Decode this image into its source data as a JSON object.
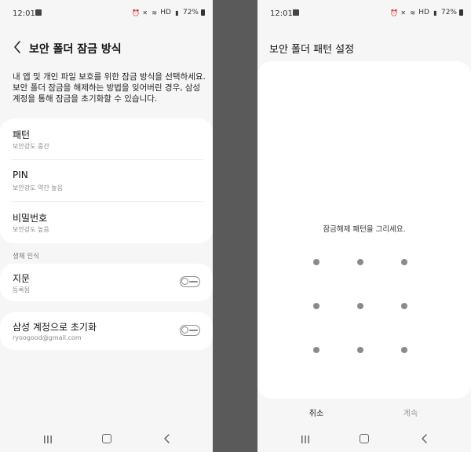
{
  "status": {
    "time": "12:01",
    "network": "HD",
    "battery": "72%"
  },
  "left": {
    "title": "보안 폴더 잠금 방식",
    "intro": "내 앱 및 개인 파일 보호를 위한 잠금 방식을 선택하세요. 보안 폴더 잠금을 해제하는 방법을 잊어버린 경우, 삼성 계정을 통해 잠금을 초기화할 수 있습니다.",
    "options": [
      {
        "title": "패턴",
        "sub": "보안강도 중간"
      },
      {
        "title": "PIN",
        "sub": "보안강도 약간 높음"
      },
      {
        "title": "비밀번호",
        "sub": "보안강도 높음"
      }
    ],
    "biometrics_label": "생체 인식",
    "fingerprint": {
      "title": "지문",
      "sub": "등록됨",
      "enabled": false
    },
    "samsung_reset": {
      "title": "삼성 계정으로 초기화",
      "sub": "ryoogood@gmail.com",
      "enabled": false
    }
  },
  "right": {
    "title": "보안 폴더 패턴 설정",
    "instruction": "잠금해제 패턴을 그리세요.",
    "cancel_label": "취소",
    "continue_label": "계속",
    "continue_enabled": false,
    "grid": {
      "rows": 3,
      "cols": 3
    }
  },
  "colors": {
    "background": "#f6f6f6",
    "card": "#ffffff",
    "dot": "#8a8a8a",
    "gap": "#5a5a5a"
  },
  "icons": {
    "back": "chevron-left-icon",
    "recent": "recent-apps-icon",
    "home": "home-icon",
    "nav_back": "nav-back-icon"
  }
}
